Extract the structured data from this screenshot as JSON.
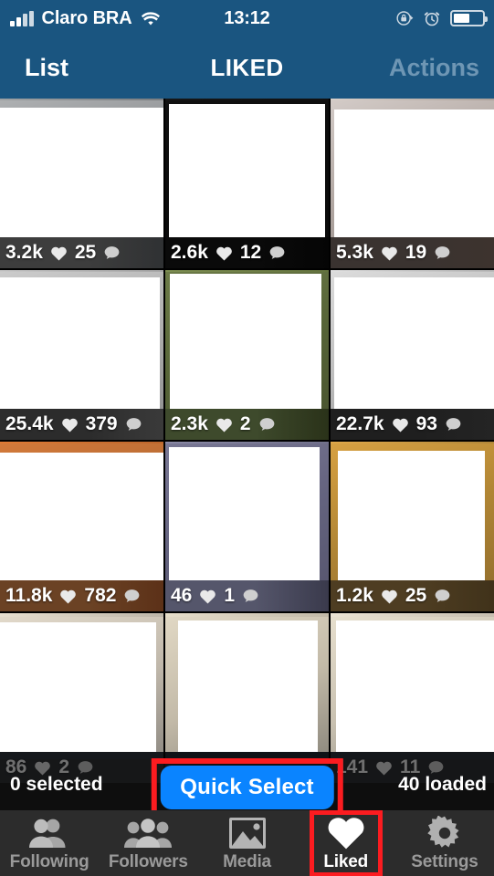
{
  "status_bar": {
    "carrier": "Claro BRA",
    "time": "13:12",
    "signal_bars_filled": 2,
    "signal_bars_total": 4,
    "wifi_icon": "wifi-icon",
    "rotation_lock_icon": "rotation-lock-icon",
    "alarm_icon": "alarm-clock-icon",
    "battery_icon": "battery-icon",
    "battery_percent": 55,
    "background_color": "#1a5580"
  },
  "nav_bar": {
    "left_label": "List",
    "title": "LIKED",
    "right_label": "Actions",
    "right_disabled": true,
    "background_color": "#1a5580",
    "disabled_color": "#6e96b4"
  },
  "grid": {
    "columns": 3,
    "rows": [
      [
        {
          "likes": "3.2k",
          "comments": "25",
          "heart_icon": "heart-icon",
          "comment_icon": "comment-icon",
          "frame_color": "#b9bbbd",
          "strip_color": "#3d3d3d"
        },
        {
          "likes": "2.6k",
          "comments": "12",
          "heart_icon": "heart-icon",
          "comment_icon": "comment-icon",
          "frame_color": "#0d0d0d",
          "strip_color": "#0a0a0a"
        },
        {
          "likes": "5.3k",
          "comments": "19",
          "heart_icon": "heart-icon",
          "comment_icon": "comment-icon",
          "frame_color": "#cfc9c6",
          "strip_color": "#3a3330"
        }
      ],
      [
        {
          "likes": "25.4k",
          "comments": "379",
          "heart_icon": "heart-icon",
          "comment_icon": "comment-icon",
          "frame_color": "#cdcdcd",
          "strip_color": "#2c2c2c"
        },
        {
          "likes": "2.3k",
          "comments": "2",
          "heart_icon": "heart-icon",
          "comment_icon": "comment-icon",
          "frame_color": "#5e6b3f",
          "strip_color": "#3e4a2c"
        },
        {
          "likes": "22.7k",
          "comments": "93",
          "heart_icon": "heart-icon",
          "comment_icon": "comment-icon",
          "frame_color": "#d9d9d9",
          "strip_color": "#1f1f1f"
        }
      ],
      [
        {
          "likes": "11.8k",
          "comments": "782",
          "heart_icon": "heart-icon",
          "comment_icon": "comment-icon",
          "frame_color": "#c97a3f",
          "strip_color": "#6b4224"
        },
        {
          "likes": "46",
          "comments": "1",
          "heart_icon": "heart-icon",
          "comment_icon": "comment-icon",
          "frame_color": "#6b6a86",
          "strip_color": "#55566b"
        },
        {
          "likes": "1.2k",
          "comments": "25",
          "heart_icon": "heart-icon",
          "comment_icon": "comment-icon",
          "frame_color": "#cf9a3c",
          "strip_color": "#4e3d22"
        }
      ],
      [
        {
          "likes": "86",
          "comments": "2",
          "heart_icon": "heart-icon",
          "comment_icon": "comment-icon",
          "frame_color": "#ded6c6",
          "strip_color": "#15181c"
        },
        {
          "likes": "",
          "comments": "",
          "heart_icon": "heart-icon",
          "comment_icon": "comment-icon",
          "frame_color": "#ddd3bf",
          "strip_color": "#0f1216"
        },
        {
          "likes": "141",
          "comments": "11",
          "heart_icon": "heart-icon",
          "comment_icon": "comment-icon",
          "frame_color": "#e3dccb",
          "strip_color": "#14171b"
        }
      ]
    ]
  },
  "action_bar": {
    "selected_label": "0 selected",
    "quick_select_label": "Quick Select",
    "loaded_label": "40 loaded",
    "button_color": "#0a84ff",
    "highlight_color": "#fb1c20"
  },
  "tab_bar": {
    "background_color": "#2c2c2c",
    "active_index": 3,
    "highlight_color": "#fb1c20",
    "items": [
      {
        "label": "Following",
        "icon": "two-people-icon"
      },
      {
        "label": "Followers",
        "icon": "three-people-icon"
      },
      {
        "label": "Media",
        "icon": "photo-icon"
      },
      {
        "label": "Liked",
        "icon": "heart-icon"
      },
      {
        "label": "Settings",
        "icon": "gear-icon"
      }
    ]
  }
}
